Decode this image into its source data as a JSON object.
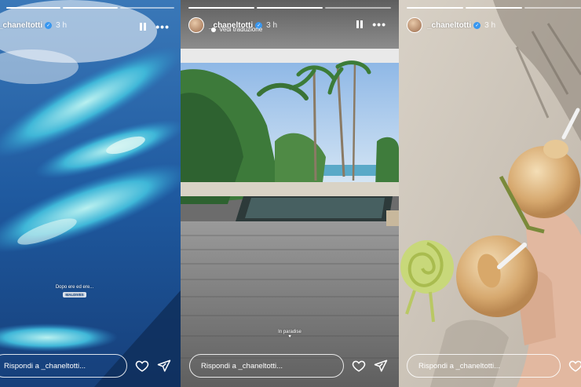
{
  "stories": [
    {
      "username": "_chaneltotti",
      "time": "3 h",
      "caption": "Dopo ere ed ere...",
      "location_tag": "MALDIVES",
      "reply_placeholder": "Rispondi a _chaneltotti...",
      "icons": [
        "pause-icon",
        "more-icon",
        "heart-icon",
        "send-icon"
      ]
    },
    {
      "username": "_chaneltotti",
      "time": "3 h",
      "translate_label": "Vedi traduzione",
      "caption": "In paradise",
      "caption_emoji": "♥",
      "reply_placeholder": "Rispondi a _chaneltotti...",
      "icons": [
        "pause-icon",
        "more-icon",
        "heart-icon",
        "send-icon"
      ]
    },
    {
      "username": "_chaneltotti",
      "time": "3 h",
      "reply_placeholder": "Rispondi a _chaneltotti...",
      "icons": [
        "heart-icon"
      ]
    }
  ]
}
